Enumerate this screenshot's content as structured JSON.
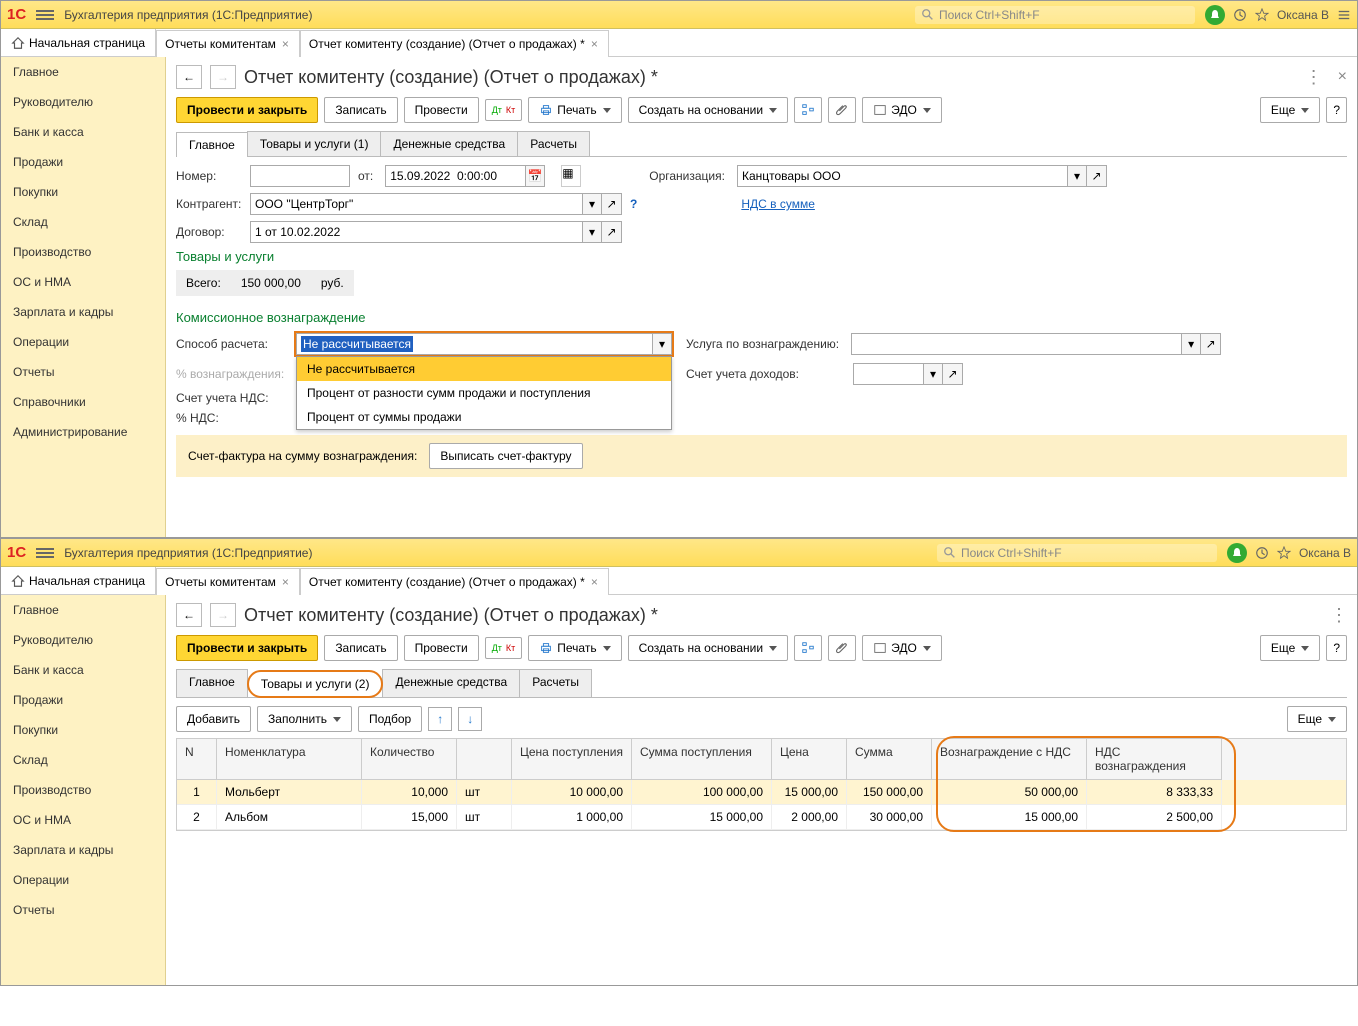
{
  "app_title": "Бухгалтерия предприятия  (1С:Предприятие)",
  "search_placeholder": "Поиск Ctrl+Shift+F",
  "user": "Оксана В",
  "home_tab": "Начальная страница",
  "doc_tabs": [
    "Отчеты комитентам",
    "Отчет комитенту (создание) (Отчет о продажах) *"
  ],
  "sidebar": [
    "Главное",
    "Руководителю",
    "Банк и касса",
    "Продажи",
    "Покупки",
    "Склад",
    "Производство",
    "ОС и НМА",
    "Зарплата и кадры",
    "Операции",
    "Отчеты",
    "Справочники",
    "Администрирование"
  ],
  "sidebar_short": [
    "Главное",
    "Руководителю",
    "Банк и касса",
    "Продажи",
    "Покупки",
    "Склад",
    "Производство",
    "ОС и НМА",
    "Зарплата и кадры",
    "Операции",
    "Отчеты"
  ],
  "page_title": "Отчет комитенту (создание) (Отчет о продажах) *",
  "toolbar": {
    "post_close": "Провести и закрыть",
    "save": "Записать",
    "post": "Провести",
    "print": "Печать",
    "create_based": "Создать на основании",
    "edo": "ЭДО",
    "more": "Еще"
  },
  "inner_tabs_top": [
    "Главное",
    "Товары и услуги (1)",
    "Денежные средства",
    "Расчеты"
  ],
  "inner_tabs_bot": [
    "Главное",
    "Товары и услуги (2)",
    "Денежные средства",
    "Расчеты"
  ],
  "form": {
    "number_lbl": "Номер:",
    "date_lbl": "от:",
    "date_val": "15.09.2022  0:00:00",
    "org_lbl": "Организация:",
    "org_val": "Канцтовары ООО",
    "counterparty_lbl": "Контрагент:",
    "counterparty_val": "ООО \"ЦентрТорг\"",
    "nds_link": "НДС в сумме",
    "contract_lbl": "Договор:",
    "contract_val": "1 от 10.02.2022",
    "goods_section": "Товары и услуги",
    "total_lbl": "Всего:",
    "total_val": "150 000,00",
    "total_cur": "руб.",
    "commission_section": "Комиссионное вознаграждение",
    "calc_method_lbl": "Способ расчета:",
    "calc_method_val": "Не рассчитывается",
    "calc_options": [
      "Не рассчитывается",
      "Процент от разности сумм продажи и поступления",
      "Процент от суммы продажи"
    ],
    "service_lbl": "Услуга по вознаграждению:",
    "pct_lbl": "% вознаграждения:",
    "income_acc_lbl": "Счет учета доходов:",
    "vat_acc_lbl": "Счет учета НДС:",
    "vat_pct_lbl": "% НДС:",
    "invoice_lbl": "Счет-фактура на сумму вознаграждения:",
    "invoice_btn": "Выписать счет-фактуру"
  },
  "goods_toolbar": {
    "add": "Добавить",
    "fill": "Заполнить",
    "select": "Подбор",
    "more": "Еще"
  },
  "goods_table": {
    "headers": [
      "N",
      "Номенклатура",
      "Количество",
      "",
      "Цена поступления",
      "Сумма поступления",
      "Цена",
      "Сумма",
      "Вознаграждение с НДС",
      "НДС вознаграждения"
    ],
    "rows": [
      {
        "n": "1",
        "nom": "Мольберт",
        "qty": "10,000",
        "unit": "шт",
        "price_in": "10 000,00",
        "sum_in": "100 000,00",
        "price": "15 000,00",
        "sum": "150 000,00",
        "comm": "50 000,00",
        "vat": "8 333,33"
      },
      {
        "n": "2",
        "nom": "Альбом",
        "qty": "15,000",
        "unit": "шт",
        "price_in": "1 000,00",
        "sum_in": "15 000,00",
        "price": "2 000,00",
        "sum": "30 000,00",
        "comm": "15 000,00",
        "vat": "2 500,00"
      }
    ]
  }
}
